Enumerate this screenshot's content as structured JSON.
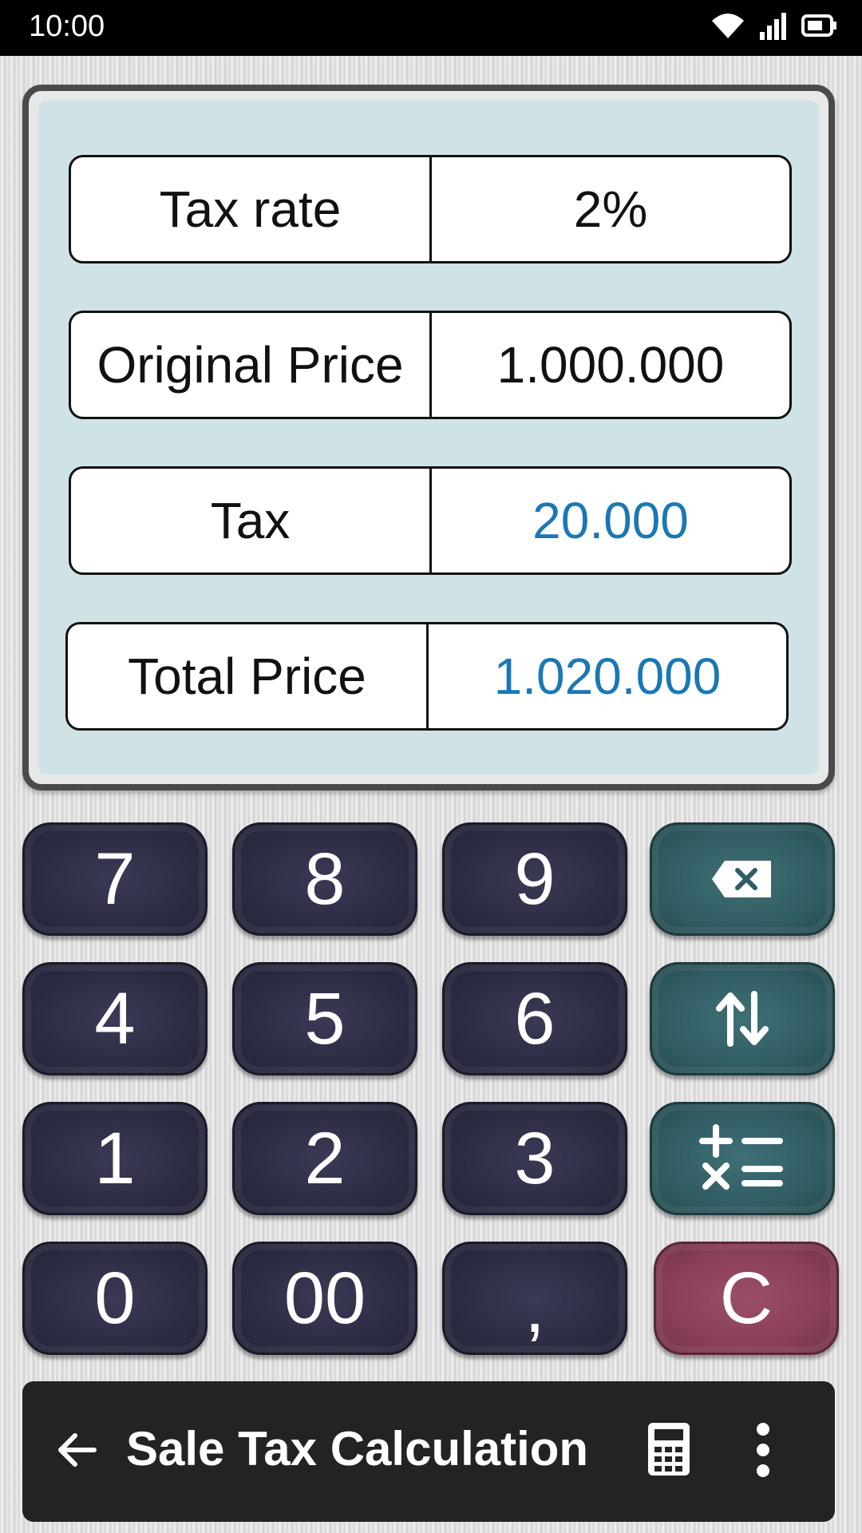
{
  "status_bar": {
    "time": "10:00",
    "icons": [
      "wifi-icon",
      "signal-icon",
      "battery-icon"
    ]
  },
  "display": {
    "rows": [
      {
        "label": "Tax rate",
        "value": "2%"
      },
      {
        "label": "Original Price",
        "value": "1.000.000"
      },
      {
        "label": "Tax",
        "value": "20.000"
      },
      {
        "label": "Total Price",
        "value": "1.020.000"
      }
    ]
  },
  "keypad": {
    "keys": [
      {
        "label": "7"
      },
      {
        "label": "8"
      },
      {
        "label": "9"
      },
      {
        "label": "",
        "icon": "backspace-icon"
      },
      {
        "label": "4"
      },
      {
        "label": "5"
      },
      {
        "label": "6"
      },
      {
        "label": "",
        "icon": "swap-arrows-icon"
      },
      {
        "label": "1"
      },
      {
        "label": "2"
      },
      {
        "label": "3"
      },
      {
        "label": "",
        "icon": "operators-icon"
      },
      {
        "label": "0"
      },
      {
        "label": "00"
      },
      {
        "label": ","
      },
      {
        "label": "C"
      }
    ]
  },
  "app_bar": {
    "title": "Sale Tax Calculation",
    "icons": [
      "back-arrow-icon",
      "calculator-icon",
      "more-vert-icon"
    ]
  },
  "colors": {
    "display_bg": "#cfe3e6",
    "result_text": "#1a78b4",
    "number_key": "#2c2c44",
    "function_key": "#305d63",
    "clear_key": "#8a3f5a",
    "app_bar_bg": "#232323"
  }
}
